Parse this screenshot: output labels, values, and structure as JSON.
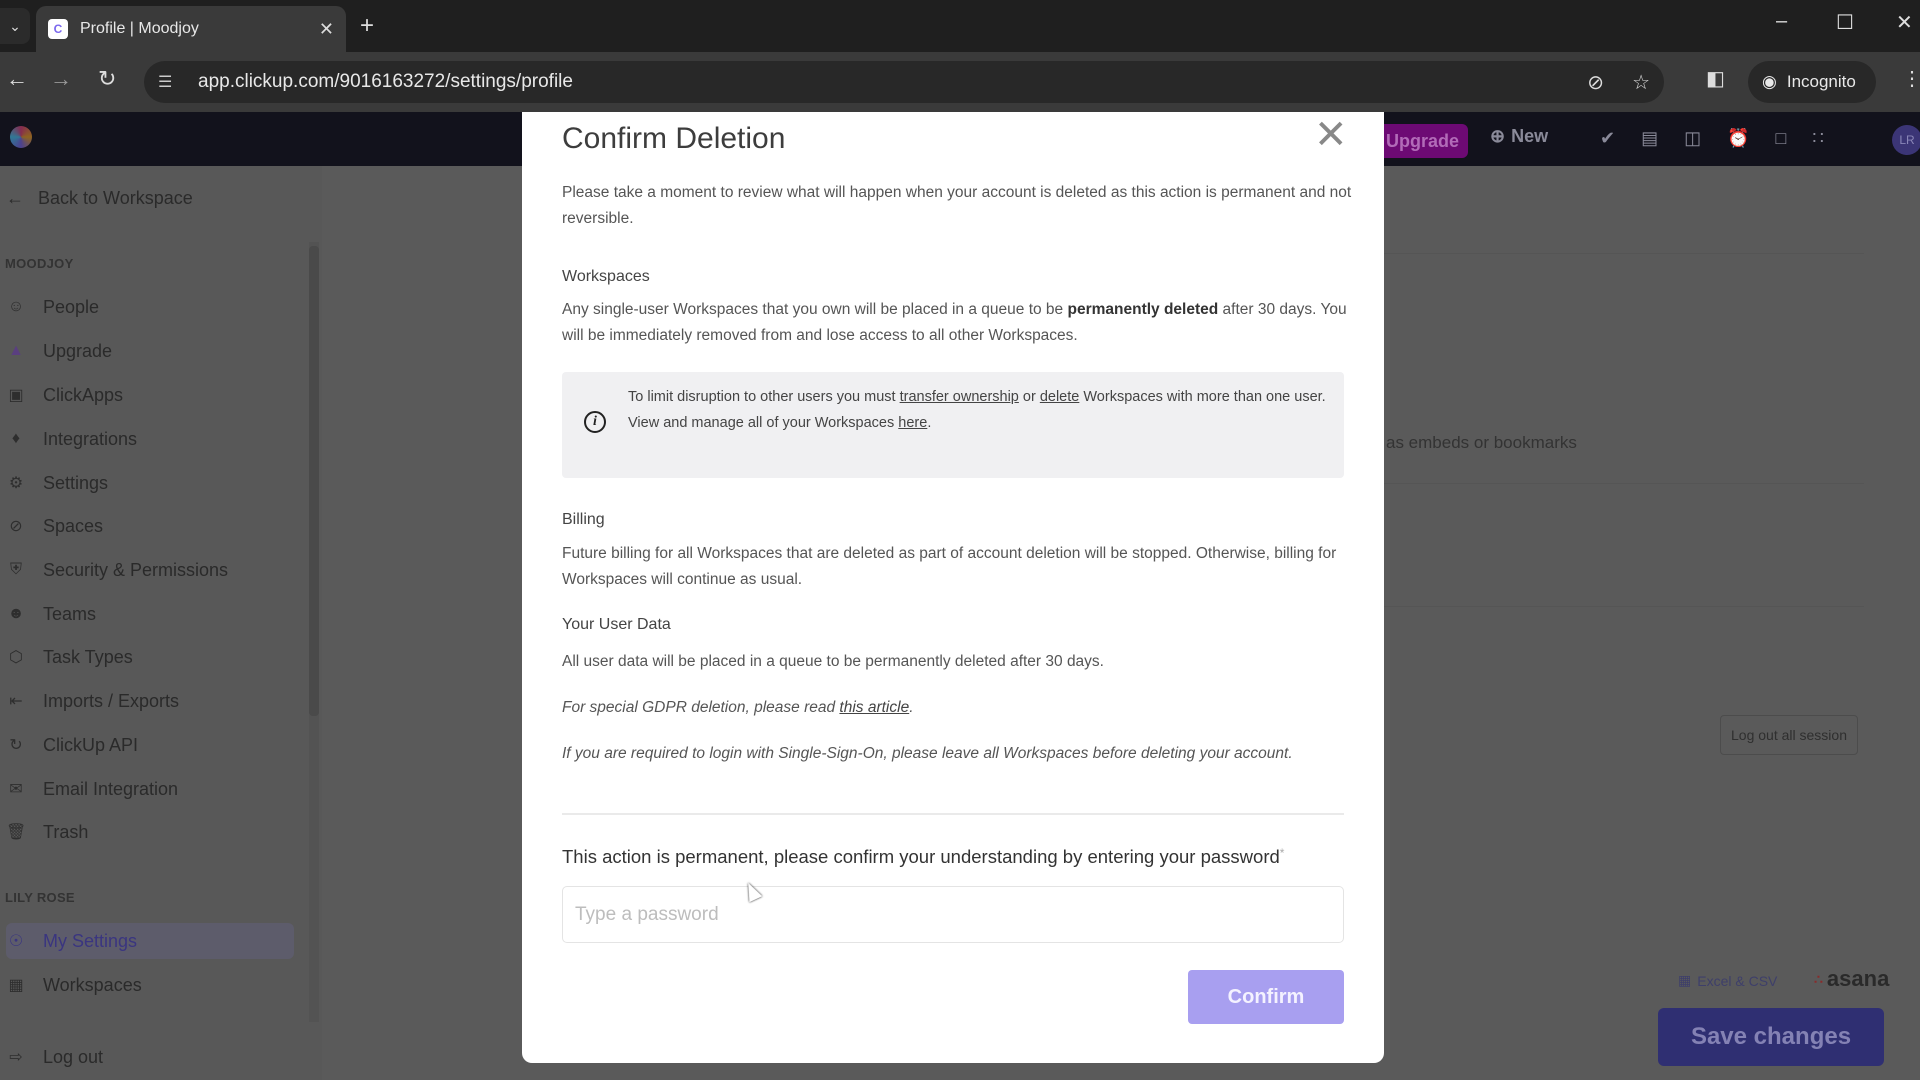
{
  "browser": {
    "tab_title": "Profile | Moodjoy",
    "url": "app.clickup.com/9016163272/settings/profile",
    "incognito_label": "Incognito",
    "icons": {
      "tab_dropdown": "chevron-down-icon",
      "close_tab": "close-icon",
      "new_tab": "plus-icon",
      "back": "arrow-left-icon",
      "forward": "arrow-right-icon",
      "reload": "reload-icon",
      "site_info": "tune-icon",
      "eye_off": "eye-off-icon",
      "bookmark": "star-icon",
      "side_panel": "side-panel-icon",
      "menu": "kebab-icon"
    }
  },
  "app_header": {
    "upgrade_label": "Upgrade",
    "new_label": "New",
    "avatar_initials": "LR"
  },
  "sidebar": {
    "back_label": "Back to Workspace",
    "workspace_section": "MOODJOY",
    "workspace_items": [
      {
        "label": "People",
        "icon": "person-icon"
      },
      {
        "label": "Upgrade",
        "icon": "upgrade-icon"
      },
      {
        "label": "ClickApps",
        "icon": "clickapps-icon"
      },
      {
        "label": "Integrations",
        "icon": "puzzle-icon"
      },
      {
        "label": "Settings",
        "icon": "gear-icon"
      },
      {
        "label": "Spaces",
        "icon": "planet-icon"
      },
      {
        "label": "Security & Permissions",
        "icon": "shield-icon"
      },
      {
        "label": "Teams",
        "icon": "team-icon"
      },
      {
        "label": "Task Types",
        "icon": "cube-icon"
      },
      {
        "label": "Imports / Exports",
        "icon": "import-icon"
      },
      {
        "label": "ClickUp API",
        "icon": "api-icon"
      },
      {
        "label": "Email Integration",
        "icon": "mail-icon"
      },
      {
        "label": "Trash",
        "icon": "trash-icon"
      }
    ],
    "user_section": "LILY ROSE",
    "user_items": [
      {
        "label": "My Settings",
        "icon": "user-circle-icon",
        "active": true
      },
      {
        "label": "Workspaces",
        "icon": "workspaces-icon"
      }
    ],
    "logout_label": "Log out"
  },
  "background": {
    "embeds_text": "as embeds or bookmarks",
    "logout_sessions_label": "Log out all session",
    "excel_label": "Excel & CSV",
    "asana_label": "asana",
    "save_label": "Save changes"
  },
  "modal": {
    "title": "Confirm Deletion",
    "intro": "Please take a moment to review what will happen when your account is deleted as this action is permanent and not reversible.",
    "workspaces_heading": "Workspaces",
    "workspaces_text_pre": "Any single-user Workspaces that you own will be placed in a queue to be ",
    "workspaces_text_bold": "permanently deleted",
    "workspaces_text_post": " after 30 days. You will be immediately removed from and lose access to all other Workspaces.",
    "callout": {
      "pre": "To limit disruption to other users you must ",
      "link1": "transfer ownership",
      "mid1": " or ",
      "link2": "delete",
      "mid2": " Workspaces with more than one user. View and manage all of your Workspaces ",
      "link3": "here",
      "post": "."
    },
    "billing_heading": "Billing",
    "billing_text": "Future billing for all Workspaces that are deleted as part of account deletion will be stopped. Otherwise, billing for Workspaces will continue as usual.",
    "userdata_heading": "Your User Data",
    "userdata_text": "All user data will be placed in a queue to be permanently deleted after 30 days.",
    "gdpr_pre": "For special GDPR deletion, please read ",
    "gdpr_link": "this article",
    "gdpr_post": ".",
    "sso_text": "If you are required to login with Single-Sign-On, please leave all Workspaces before deleting your account.",
    "prompt": "This action is permanent, please confirm your understanding by entering your password",
    "required_mark": "*",
    "password_placeholder": "Type a password",
    "password_value": "",
    "confirm_label": "Confirm",
    "accent_color": "#a89ff0"
  }
}
